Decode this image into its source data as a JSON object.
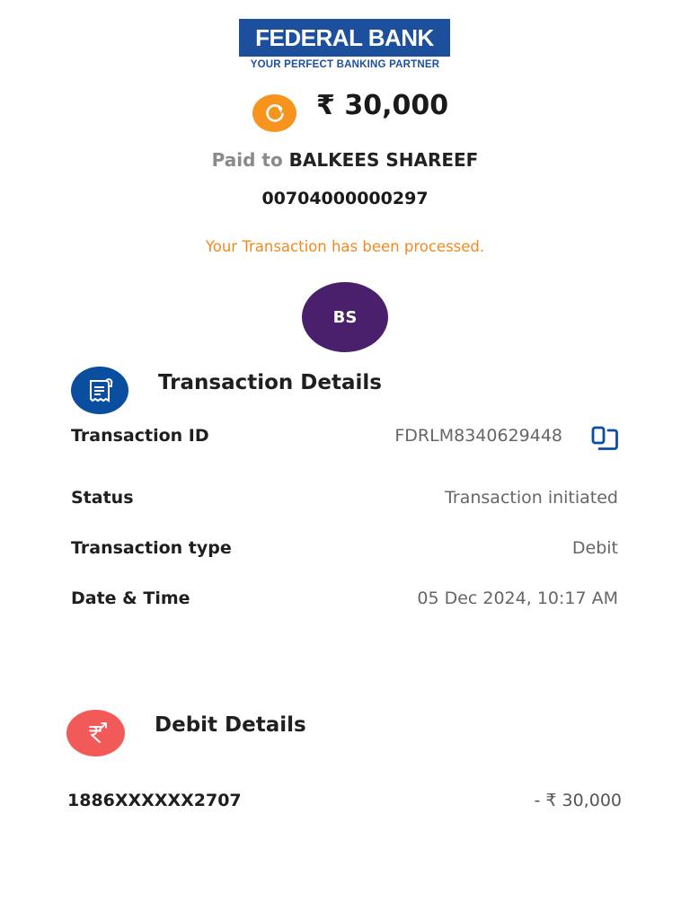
{
  "brand": {
    "name": "FEDERAL BANK",
    "tagline": "YOUR PERFECT BANKING PARTNER",
    "color": "#1c4f9c"
  },
  "summary": {
    "status_icon": "pending-refresh-icon",
    "amount": "₹ 30,000",
    "paid_prefix": "Paid to",
    "payee": "BALKEES SHAREEF",
    "account_number": "00704000000297",
    "message": "Your Transaction has been processed.",
    "avatar_initials": "BS"
  },
  "transaction_details": {
    "title": "Transaction Details",
    "icon": "receipt-icon",
    "rows": [
      {
        "label": "Transaction ID",
        "value": "FDRLM8340629448"
      },
      {
        "label": "Status",
        "value": "Transaction initiated"
      },
      {
        "label": "Transaction type",
        "value": "Debit"
      },
      {
        "label": "Date & Time",
        "value": "05 Dec 2024, 10:17 AM"
      }
    ]
  },
  "debit_details": {
    "title": "Debit Details",
    "icon": "rupee-transfer-icon",
    "account": "1886XXXXXX2707",
    "amount": "- ₹ 30,000"
  },
  "colors": {
    "pending": "#f7941d",
    "message": "#f28a1e",
    "avatar": "#4a1f6b",
    "transaction_icon": "#0a4ea0",
    "debit_icon": "#f25a5a"
  }
}
